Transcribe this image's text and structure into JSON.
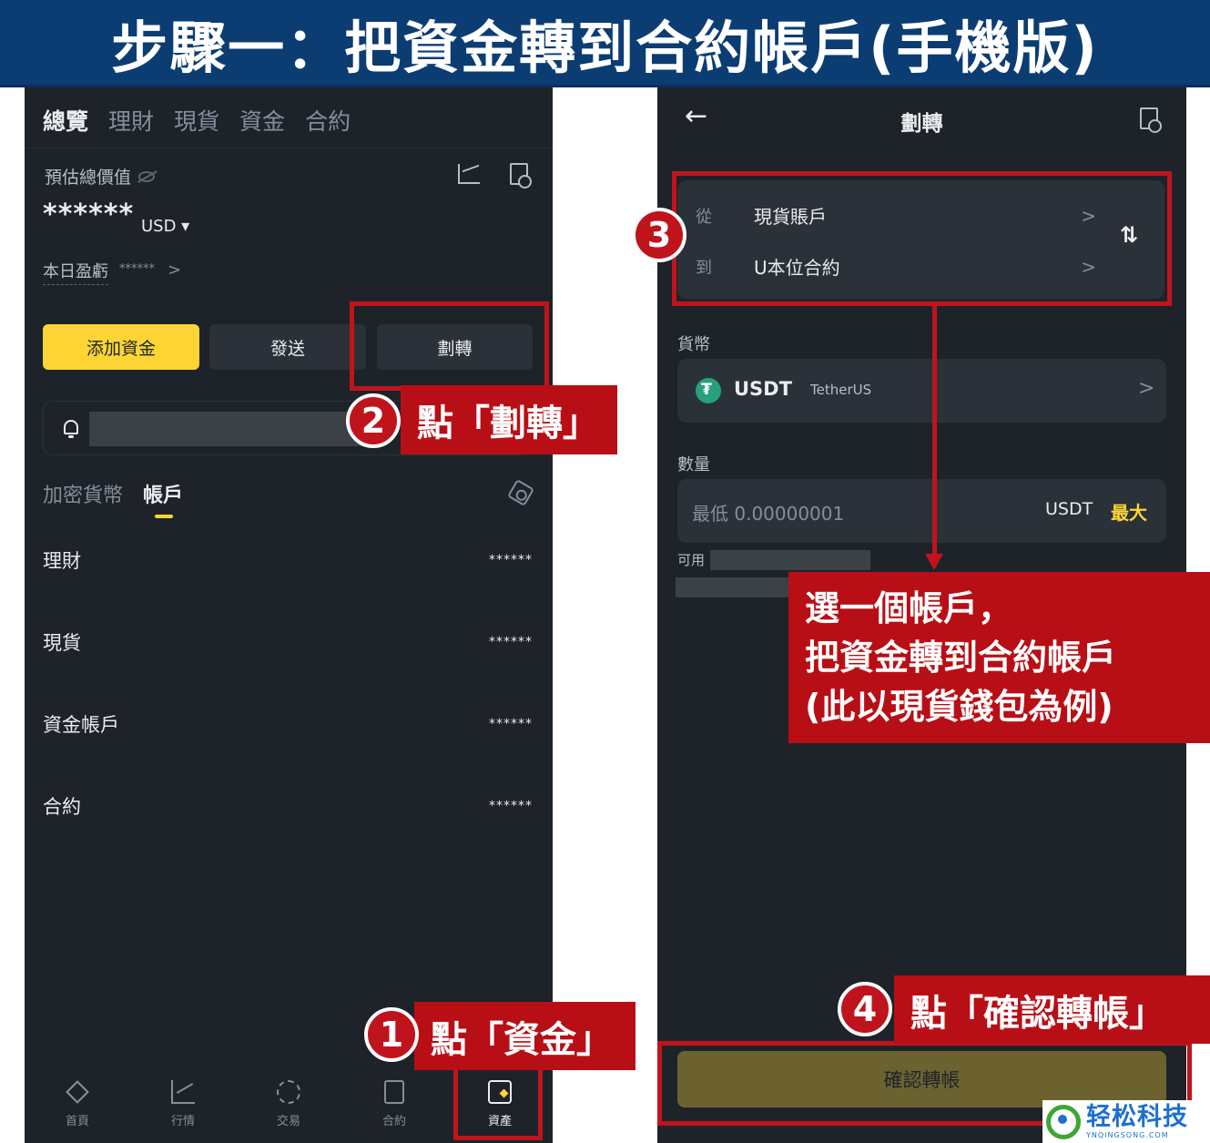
{
  "banner": {
    "title": "步驟一：把資金轉到合約帳戶(手機版)"
  },
  "left_phone": {
    "tabs": [
      "總覽",
      "理財",
      "現貨",
      "資金",
      "合約"
    ],
    "est_label": "預估總價值",
    "balance": "******",
    "currency": "USD ▾",
    "pnl_label": "本日盈虧",
    "pnl_value": "******",
    "pnl_arrow": ">",
    "buttons": {
      "deposit": "添加資金",
      "send": "發送",
      "transfer": "劃轉"
    },
    "subtabs": [
      "加密貨幣",
      "帳戶"
    ],
    "accounts": [
      {
        "name": "理財",
        "value": "******"
      },
      {
        "name": "現貨",
        "value": "******"
      },
      {
        "name": "資金帳戶",
        "value": "******"
      },
      {
        "name": "合約",
        "value": "******"
      }
    ],
    "nav": [
      {
        "label": "首頁",
        "icon": "home-icon"
      },
      {
        "label": "行情",
        "icon": "market-icon"
      },
      {
        "label": "交易",
        "icon": "trade-icon"
      },
      {
        "label": "合約",
        "icon": "futures-icon"
      },
      {
        "label": "資產",
        "icon": "assets-icon"
      }
    ]
  },
  "right_phone": {
    "back": "←",
    "title": "劃轉",
    "from_label": "從",
    "from_value": "現貨賬戶",
    "to_label": "到",
    "to_value": "U本位合約",
    "chevron": ">",
    "swap": "⇅",
    "currency_label": "貨幣",
    "coin_code": "USDT",
    "coin_name": "TetherUS",
    "amount_label": "數量",
    "amount_placeholder": "最低 0.00000001",
    "amount_unit": "USDT",
    "amount_max": "最大",
    "available_label": "可用",
    "confirm_label": "確認轉帳"
  },
  "annotations": {
    "step1": {
      "num": "1",
      "text": "點「資金」"
    },
    "step2": {
      "num": "2",
      "text": "點「劃轉」"
    },
    "step3": {
      "num": "3",
      "line1": "選一個帳戶，",
      "line2": "把資金轉到合約帳戶",
      "line3": "(此以現貨錢包為例)"
    },
    "step4": {
      "num": "4",
      "text": "點「確認轉帳」"
    },
    "colors": {
      "red": "#c0141c",
      "yellow": "#fcd535",
      "bg": "#1e2329"
    }
  },
  "watermark": {
    "cn": "轻松科技",
    "en": "YNQINGSONG.COM"
  }
}
